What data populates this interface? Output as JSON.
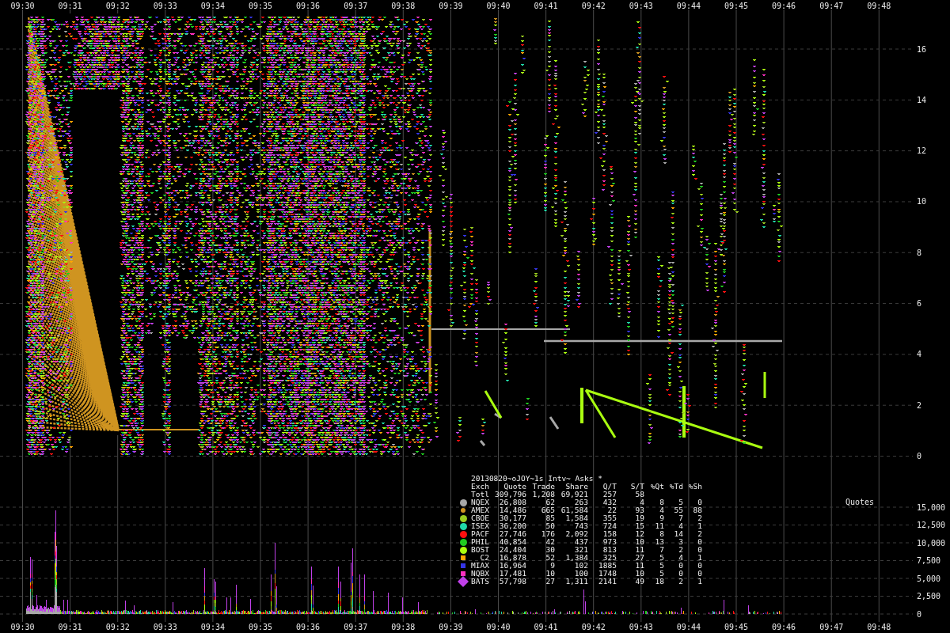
{
  "top_time_axis": [
    "09:30",
    "09:31",
    "09:32",
    "09:33",
    "09:34",
    "09:35",
    "09:36",
    "09:37",
    "09:38",
    "09:39",
    "09:40",
    "09:41",
    "09:42",
    "09:43",
    "09:44",
    "09:45",
    "09:46",
    "09:47",
    "09:48"
  ],
  "price_axis": [
    "16",
    "14",
    "12",
    "10",
    "8",
    "6",
    "4",
    "2",
    "0"
  ],
  "legend": {
    "title": "20130820~oJOY~1s Intv~ Asks *",
    "columns": [
      "Exch",
      "Quote",
      "Trade",
      "Share",
      "Q/T",
      "S/T",
      "%Qt",
      "%Td",
      "%Sh"
    ],
    "total": [
      "Totl",
      "309,796",
      "1,208",
      "69,921",
      "257",
      "58"
    ],
    "exchanges": [
      {
        "name": "NQEX",
        "kind": "circle",
        "color": "#a8a8a8",
        "values": [
          "26,808",
          "62",
          "263",
          "432",
          "4",
          "8",
          "5",
          "0"
        ]
      },
      {
        "name": "AMEX",
        "kind": "dot",
        "color": "#cf9420",
        "values": [
          "14,486",
          "665",
          "61,584",
          "22",
          "93",
          "4",
          "55",
          "88"
        ]
      },
      {
        "name": "CBOE",
        "kind": "circle",
        "color": "#9acd20",
        "values": [
          "30,177",
          "85",
          "1,584",
          "355",
          "19",
          "9",
          "7",
          "2"
        ]
      },
      {
        "name": "ISEX",
        "kind": "circle",
        "color": "#20d8a8",
        "values": [
          "36,200",
          "50",
          "743",
          "724",
          "15",
          "11",
          "4",
          "1"
        ]
      },
      {
        "name": "PACF",
        "kind": "circle",
        "color": "#ff1010",
        "values": [
          "27,746",
          "176",
          "2,092",
          "158",
          "12",
          "8",
          "14",
          "2"
        ]
      },
      {
        "name": "PHIL",
        "kind": "circle",
        "color": "#20cc20",
        "values": [
          "40,854",
          "42",
          "437",
          "973",
          "10",
          "13",
          "3",
          "0"
        ]
      },
      {
        "name": "BOST",
        "kind": "circle",
        "color": "#aaff10",
        "values": [
          "24,404",
          "30",
          "321",
          "813",
          "11",
          "7",
          "2",
          "0"
        ]
      },
      {
        "name": "C2",
        "kind": "square",
        "color": "#ffa500",
        "values": [
          "16,878",
          "52",
          "1,384",
          "325",
          "27",
          "5",
          "4",
          "1"
        ]
      },
      {
        "name": "MIAX",
        "kind": "square",
        "color": "#3535e8",
        "values": [
          "16,964",
          "9",
          "102",
          "1885",
          "11",
          "5",
          "0",
          "0"
        ]
      },
      {
        "name": "NQBX",
        "kind": "square",
        "color": "#ff30c0",
        "values": [
          "17,481",
          "10",
          "100",
          "1748",
          "10",
          "5",
          "0",
          "0"
        ]
      },
      {
        "name": "BATS",
        "kind": "diamond",
        "color": "#c040e8",
        "values": [
          "57,798",
          "27",
          "1,311",
          "2141",
          "49",
          "18",
          "2",
          "1"
        ]
      }
    ]
  },
  "quotes_chart": {
    "title": "Quotes",
    "y_axis": [
      "15,000",
      "12,500",
      "10,000",
      "7,500",
      "5,000",
      "2,500",
      "0"
    ]
  },
  "bottom_time_axis": [
    "09:30",
    "09:31",
    "09:32",
    "09:33",
    "09:34",
    "09:35",
    "09:36",
    "09:37",
    "09:38",
    "09:39",
    "09:40",
    "09:41",
    "09:42",
    "09:43",
    "09:44",
    "09:45",
    "09:46",
    "09:47",
    "09:48"
  ]
}
